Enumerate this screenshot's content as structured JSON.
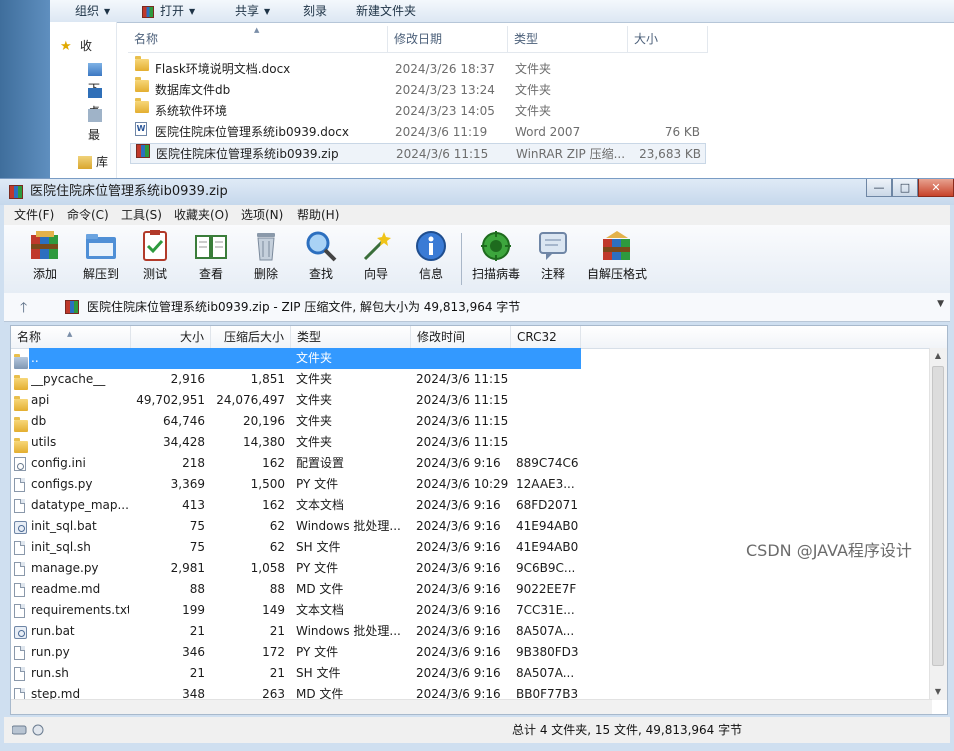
{
  "explorer": {
    "toolbar": {
      "organize": "组织",
      "open": "打开",
      "share": "共享",
      "burn": "刻录",
      "new_folder": "新建文件夹"
    },
    "nav": {
      "favorites": "收",
      "downloads": "下",
      "desktop": "桌",
      "recent": "最",
      "libraries": "库"
    },
    "columns": {
      "name": "名称",
      "date": "修改日期",
      "type": "类型",
      "size": "大小"
    },
    "files": [
      {
        "name": "Flask环境说明文档.docx",
        "date": "2024/3/26 18:37",
        "type": "文件夹",
        "size": "",
        "icon": "folder-icon"
      },
      {
        "name": "数据库文件db",
        "date": "2024/3/23 13:24",
        "type": "文件夹",
        "size": "",
        "icon": "folder-icon"
      },
      {
        "name": "系统软件环境",
        "date": "2024/3/23 14:05",
        "type": "文件夹",
        "size": "",
        "icon": "folder-icon"
      },
      {
        "name": "医院住院床位管理系统ib0939.docx",
        "date": "2024/3/6 11:19",
        "type": "Word 2007",
        "size": "76 KB",
        "icon": "word-doc-icon"
      },
      {
        "name": "医院住院床位管理系统ib0939.zip",
        "date": "2024/3/6 11:15",
        "type": "WinRAR ZIP 压缩...",
        "size": "23,683 KB",
        "icon": "winrar-archive-icon"
      }
    ]
  },
  "winrar": {
    "title": "医院住院床位管理系统ib0939.zip",
    "window_buttons": {
      "minimize": "—",
      "maximize": "□",
      "close": "✕"
    },
    "menu": [
      "文件(F)",
      "命令(C)",
      "工具(S)",
      "收藏夹(O)",
      "选项(N)",
      "帮助(H)"
    ],
    "toolbar": [
      "添加",
      "解压到",
      "测试",
      "查看",
      "删除",
      "查找",
      "向导",
      "信息",
      "扫描病毒",
      "注释",
      "自解压格式"
    ],
    "address": "医院住院床位管理系统ib0939.zip - ZIP 压缩文件, 解包大小为 49,813,964 字节",
    "columns": {
      "name": "名称",
      "size": "大小",
      "packed": "压缩后大小",
      "type": "类型",
      "mtime": "修改时间",
      "crc": "CRC32"
    },
    "rows": [
      {
        "name": "..",
        "size": "",
        "packed": "",
        "type": "文件夹",
        "mtime": "",
        "crc": "",
        "icon": "parent-folder-icon",
        "selected": true
      },
      {
        "name": "__pycache__",
        "size": "2,916",
        "packed": "1,851",
        "type": "文件夹",
        "mtime": "2024/3/6 11:15",
        "crc": "",
        "icon": "folder-icon"
      },
      {
        "name": "api",
        "size": "49,702,951",
        "packed": "24,076,497",
        "type": "文件夹",
        "mtime": "2024/3/6 11:15",
        "crc": "",
        "icon": "folder-icon"
      },
      {
        "name": "db",
        "size": "64,746",
        "packed": "20,196",
        "type": "文件夹",
        "mtime": "2024/3/6 11:15",
        "crc": "",
        "icon": "folder-icon"
      },
      {
        "name": "utils",
        "size": "34,428",
        "packed": "14,380",
        "type": "文件夹",
        "mtime": "2024/3/6 11:15",
        "crc": "",
        "icon": "folder-icon"
      },
      {
        "name": "config.ini",
        "size": "218",
        "packed": "162",
        "type": "配置设置",
        "mtime": "2024/3/6 9:16",
        "crc": "889C74C6",
        "icon": "settings-file-icon"
      },
      {
        "name": "configs.py",
        "size": "3,369",
        "packed": "1,500",
        "type": "PY 文件",
        "mtime": "2024/3/6 10:29",
        "crc": "12AAE3...",
        "icon": "file-icon"
      },
      {
        "name": "datatype_map....",
        "size": "413",
        "packed": "162",
        "type": "文本文档",
        "mtime": "2024/3/6 9:16",
        "crc": "68FD2071",
        "icon": "file-icon"
      },
      {
        "name": "init_sql.bat",
        "size": "75",
        "packed": "62",
        "type": "Windows 批处理...",
        "mtime": "2024/3/6 9:16",
        "crc": "41E94AB0",
        "icon": "batch-file-icon"
      },
      {
        "name": "init_sql.sh",
        "size": "75",
        "packed": "62",
        "type": "SH 文件",
        "mtime": "2024/3/6 9:16",
        "crc": "41E94AB0",
        "icon": "file-icon"
      },
      {
        "name": "manage.py",
        "size": "2,981",
        "packed": "1,058",
        "type": "PY 文件",
        "mtime": "2024/3/6 9:16",
        "crc": "9C6B9C...",
        "icon": "file-icon"
      },
      {
        "name": "readme.md",
        "size": "88",
        "packed": "88",
        "type": "MD 文件",
        "mtime": "2024/3/6 9:16",
        "crc": "9022EE7F",
        "icon": "file-icon"
      },
      {
        "name": "requirements.txt",
        "size": "199",
        "packed": "149",
        "type": "文本文档",
        "mtime": "2024/3/6 9:16",
        "crc": "7CC31E...",
        "icon": "file-icon"
      },
      {
        "name": "run.bat",
        "size": "21",
        "packed": "21",
        "type": "Windows 批处理...",
        "mtime": "2024/3/6 9:16",
        "crc": "8A507A...",
        "icon": "batch-file-icon"
      },
      {
        "name": "run.py",
        "size": "346",
        "packed": "172",
        "type": "PY 文件",
        "mtime": "2024/3/6 9:16",
        "crc": "9B380FD3",
        "icon": "file-icon"
      },
      {
        "name": "run.sh",
        "size": "21",
        "packed": "21",
        "type": "SH 文件",
        "mtime": "2024/3/6 9:16",
        "crc": "8A507A...",
        "icon": "file-icon"
      },
      {
        "name": "step.md",
        "size": "348",
        "packed": "263",
        "type": "MD 文件",
        "mtime": "2024/3/6 9:16",
        "crc": "BB0F77B3",
        "icon": "file-icon"
      }
    ],
    "status": "总计 4 文件夹, 15 文件, 49,813,964 字节"
  },
  "watermark": "CSDN @JAVA程序设计"
}
